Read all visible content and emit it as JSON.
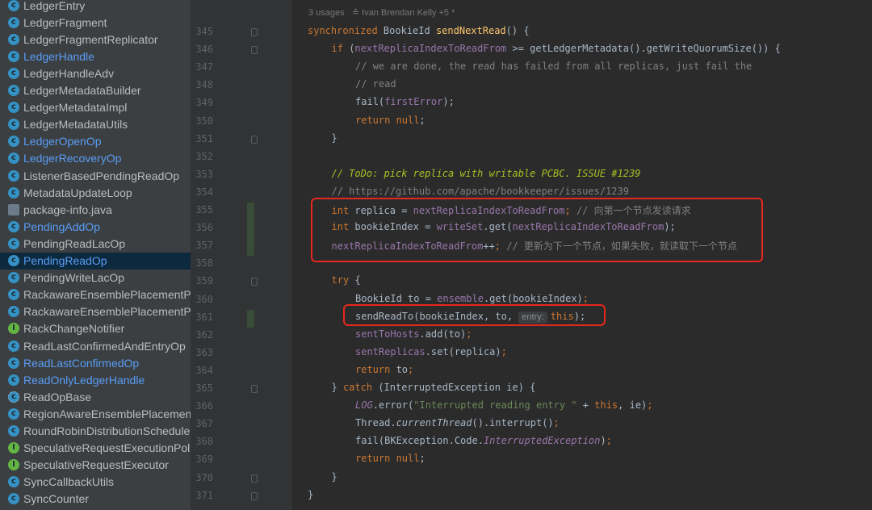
{
  "sidebar": {
    "items": [
      {
        "label": "LedgerEntry",
        "icon": "class-icon",
        "blue": false,
        "selected": false
      },
      {
        "label": "LedgerFragment",
        "icon": "class-icon",
        "blue": false,
        "selected": false
      },
      {
        "label": "LedgerFragmentReplicator",
        "icon": "class-icon",
        "blue": false,
        "selected": false
      },
      {
        "label": "LedgerHandle",
        "icon": "class-icon",
        "blue": true,
        "selected": false
      },
      {
        "label": "LedgerHandleAdv",
        "icon": "class-icon",
        "blue": false,
        "selected": false
      },
      {
        "label": "LedgerMetadataBuilder",
        "icon": "class-icon",
        "blue": false,
        "selected": false
      },
      {
        "label": "LedgerMetadataImpl",
        "icon": "class-icon",
        "blue": false,
        "selected": false
      },
      {
        "label": "LedgerMetadataUtils",
        "icon": "class-icon",
        "blue": false,
        "selected": false
      },
      {
        "label": "LedgerOpenOp",
        "icon": "class-icon",
        "blue": true,
        "selected": false
      },
      {
        "label": "LedgerRecoveryOp",
        "icon": "class-icon",
        "blue": true,
        "selected": false
      },
      {
        "label": "ListenerBasedPendingReadOp",
        "icon": "class-icon",
        "blue": false,
        "selected": false
      },
      {
        "label": "MetadataUpdateLoop",
        "icon": "class-icon",
        "blue": false,
        "selected": false
      },
      {
        "label": "package-info.java",
        "icon": "java-file-icon",
        "blue": false,
        "selected": false
      },
      {
        "label": "PendingAddOp",
        "icon": "class-icon",
        "blue": true,
        "selected": false
      },
      {
        "label": "PendingReadLacOp",
        "icon": "class-icon",
        "blue": false,
        "selected": false
      },
      {
        "label": "PendingReadOp",
        "icon": "class-icon",
        "blue": true,
        "selected": true
      },
      {
        "label": "PendingWriteLacOp",
        "icon": "class-icon",
        "blue": false,
        "selected": false
      },
      {
        "label": "RackawareEnsemblePlacementP",
        "icon": "class-icon",
        "blue": false,
        "selected": false
      },
      {
        "label": "RackawareEnsemblePlacementP",
        "icon": "class-icon",
        "blue": false,
        "selected": false
      },
      {
        "label": "RackChangeNotifier",
        "icon": "interface-icon",
        "blue": false,
        "selected": false
      },
      {
        "label": "ReadLastConfirmedAndEntryOp",
        "icon": "class-icon",
        "blue": false,
        "selected": false
      },
      {
        "label": "ReadLastConfirmedOp",
        "icon": "class-icon",
        "blue": true,
        "selected": false
      },
      {
        "label": "ReadOnlyLedgerHandle",
        "icon": "class-icon",
        "blue": true,
        "selected": false
      },
      {
        "label": "ReadOpBase",
        "icon": "abstract-class-icon",
        "blue": false,
        "selected": false
      },
      {
        "label": "RegionAwareEnsemblePlacemen",
        "icon": "class-icon",
        "blue": false,
        "selected": false
      },
      {
        "label": "RoundRobinDistributionSchedule",
        "icon": "class-icon",
        "blue": false,
        "selected": false
      },
      {
        "label": "SpeculativeRequestExecutionPol",
        "icon": "interface-icon",
        "blue": false,
        "selected": false
      },
      {
        "label": "SpeculativeRequestExecutor",
        "icon": "interface-icon",
        "blue": false,
        "selected": false
      },
      {
        "label": "SyncCallbackUtils",
        "icon": "class-icon",
        "blue": false,
        "selected": false
      },
      {
        "label": "SyncCounter",
        "icon": "class-icon",
        "blue": false,
        "selected": false
      }
    ]
  },
  "editor": {
    "usage_info": "3 usages   ≗ Ivan Brendan Kelly +5 *",
    "line_numbers": [
      "345",
      "346",
      "347",
      "348",
      "349",
      "350",
      "351",
      "352",
      "353",
      "354",
      "355",
      "356",
      "357",
      "358",
      "359",
      "360",
      "361",
      "362",
      "363",
      "364",
      "365",
      "366",
      "367",
      "368",
      "369",
      "370",
      "371"
    ],
    "lines": [
      [
        [
          "kw",
          "synchronized "
        ],
        [
          "",
          "BookieId "
        ],
        [
          "fn",
          "sendNextRead"
        ],
        [
          "",
          "() {"
        ]
      ],
      [
        [
          "kw",
          "if "
        ],
        [
          "",
          "("
        ],
        [
          "fld",
          "nextReplicaIndexToReadFrom"
        ],
        [
          "",
          " >= getLedgerMetadata().getWriteQuorumSize()) {"
        ]
      ],
      [
        [
          "cm",
          "// we are done, the read has failed from all replicas, just fail the"
        ]
      ],
      [
        [
          "cm",
          "// read"
        ]
      ],
      [
        [
          "",
          "fail("
        ],
        [
          "fld",
          "firstError"
        ],
        [
          "",
          ");"
        ]
      ],
      [
        [
          "kw",
          "return null"
        ],
        [
          "",
          ";"
        ]
      ],
      [
        [
          "",
          "}"
        ]
      ],
      [],
      [
        [
          "todo",
          "// ToDo: pick replica with writable PCBC. ISSUE #1239"
        ]
      ],
      [
        [
          "cm",
          "// https://github.com/apache/bookkeeper/issues/1239"
        ]
      ],
      [
        [
          "kw",
          "int "
        ],
        [
          "",
          "replica = "
        ],
        [
          "fld",
          "nextReplicaIndexToReadFrom"
        ],
        [
          "kw",
          "; "
        ],
        [
          "cm",
          "// 向第一个节点发读请求"
        ]
      ],
      [
        [
          "kw",
          "int "
        ],
        [
          "",
          "bookieIndex = "
        ],
        [
          "fld",
          "writeSet"
        ],
        [
          "",
          ".get("
        ],
        [
          "fld",
          "nextReplicaIndexToReadFrom"
        ],
        [
          "",
          ");"
        ]
      ],
      [
        [
          "fld",
          "nextReplicaIndexToReadFrom"
        ],
        [
          "",
          "++"
        ],
        [
          "kw",
          "; "
        ],
        [
          "cm",
          "// 更新为下一个节点，如果失败，就读取下一个节点"
        ]
      ],
      [],
      [
        [
          "kw",
          "try "
        ],
        [
          "",
          "{"
        ]
      ],
      [
        [
          "",
          "BookieId to = "
        ],
        [
          "fld",
          "ensemble"
        ],
        [
          "",
          ".get(bookieIndex)"
        ],
        [
          "kw",
          ";"
        ]
      ],
      [
        [
          "",
          "sendReadTo(bookieIndex, to, "
        ],
        [
          "hint",
          "entry:"
        ],
        [
          "kw",
          "this"
        ],
        [
          "",
          ");"
        ]
      ],
      [
        [
          "fld",
          "sentToHosts"
        ],
        [
          "",
          ".add(to)"
        ],
        [
          "kw",
          ";"
        ]
      ],
      [
        [
          "fld",
          "sentReplicas"
        ],
        [
          "",
          ".set(replica)"
        ],
        [
          "kw",
          ";"
        ]
      ],
      [
        [
          "kw",
          "return "
        ],
        [
          "",
          "to"
        ],
        [
          "kw",
          ";"
        ]
      ],
      [
        [
          "",
          "} "
        ],
        [
          "kw",
          "catch "
        ],
        [
          "",
          "(InterruptedException ie) {"
        ]
      ],
      [
        [
          "st",
          "LOG"
        ],
        [
          "",
          ".error("
        ],
        [
          "str",
          "\"Interrupted reading entry \""
        ],
        [
          "",
          " + "
        ],
        [
          "kw",
          "this"
        ],
        [
          "",
          ", ie)"
        ],
        [
          "kw",
          ";"
        ]
      ],
      [
        [
          "",
          "Thread."
        ],
        [
          "sm",
          "currentThread"
        ],
        [
          "",
          "().interrupt()"
        ],
        [
          "kw",
          ";"
        ]
      ],
      [
        [
          "",
          "fail(BKException.Code."
        ],
        [
          "st",
          "InterruptedException"
        ],
        [
          "",
          ")"
        ],
        [
          "kw",
          ";"
        ]
      ],
      [
        [
          "kw",
          "return null"
        ],
        [
          "",
          ";"
        ]
      ],
      [
        [
          "",
          "}"
        ]
      ],
      [
        [
          "",
          "}"
        ]
      ]
    ]
  }
}
